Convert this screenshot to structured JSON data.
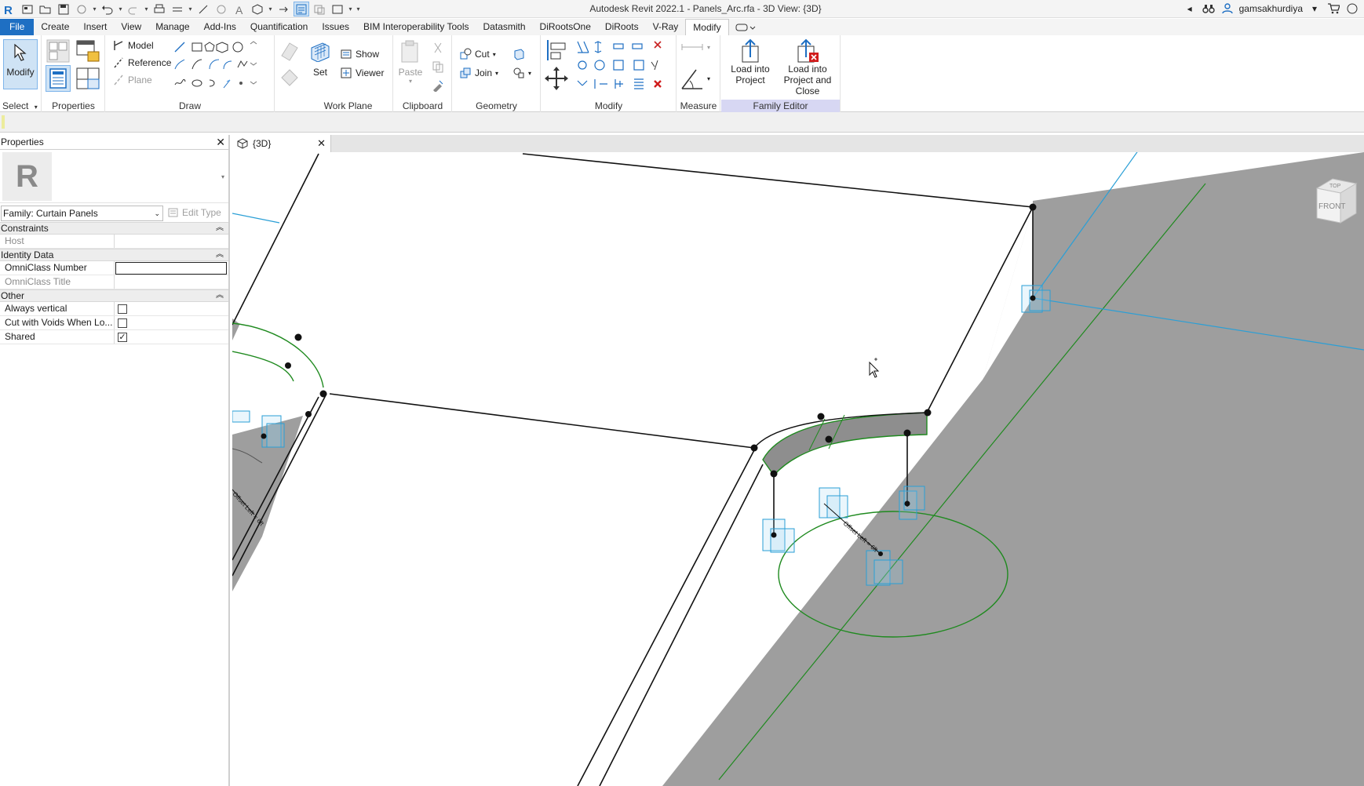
{
  "app": {
    "title": "Autodesk Revit 2022.1 - Panels_Arc.rfa - 3D View: {3D}",
    "user": "gamsakhurdiya"
  },
  "tabs": [
    "File",
    "Create",
    "Insert",
    "View",
    "Manage",
    "Add-Ins",
    "Quantification",
    "Issues",
    "BIM Interoperability Tools",
    "Datasmith",
    "DiRootsOne",
    "DiRoots",
    "V-Ray",
    "Modify"
  ],
  "active_tab": "Modify",
  "ribbon": {
    "select": {
      "modify_label": "Modify",
      "panel_label": "Select"
    },
    "properties": {
      "panel_label": "Properties"
    },
    "draw": {
      "model": "Model",
      "reference": "Reference",
      "plane": "Plane",
      "panel_label": "Draw"
    },
    "workplane": {
      "set": "Set",
      "show": "Show",
      "viewer": "Viewer",
      "panel_label": "Work Plane"
    },
    "clipboard": {
      "paste": "Paste",
      "panel_label": "Clipboard"
    },
    "geometry": {
      "cut": "Cut",
      "join": "Join",
      "panel_label": "Geometry"
    },
    "modify": {
      "panel_label": "Modify"
    },
    "measure": {
      "panel_label": "Measure"
    },
    "family_editor": {
      "load_into_project_1": "Load into",
      "load_into_project_2": "Project",
      "load_close_1": "Load into",
      "load_close_2": "Project and Close",
      "panel_label": "Family Editor"
    }
  },
  "properties": {
    "title": "Properties",
    "family_selector": "Family: Curtain Panels",
    "edit_type": "Edit Type",
    "groups": {
      "constraints": "Constraints",
      "identity": "Identity Data",
      "other": "Other"
    },
    "rows": {
      "host": "Host",
      "omniclass_number": "OmniClass Number",
      "omniclass_title": "OmniClass Title",
      "always_vertical": "Always vertical",
      "cut_with_voids": "Cut with Voids When Lo...",
      "shared": "Shared"
    },
    "checkbox_states": {
      "always_vertical": false,
      "cut_with_voids": false,
      "shared": true
    },
    "check_glyph": "✓"
  },
  "view": {
    "tab_label": "{3D}",
    "navcube_top": "TOP",
    "navcube_front": "FRONT",
    "offset_label_1": "Offset Left = 6ft",
    "offset_label_2": "Offset Left = 6ft"
  },
  "colors": {
    "accent": "#1e6fc3",
    "family_editor_panel": "#d7d7f3",
    "ground": "#9e9e9e",
    "reference_lines": "#2a9fd6",
    "arc_lines": "#1f8a1f"
  }
}
